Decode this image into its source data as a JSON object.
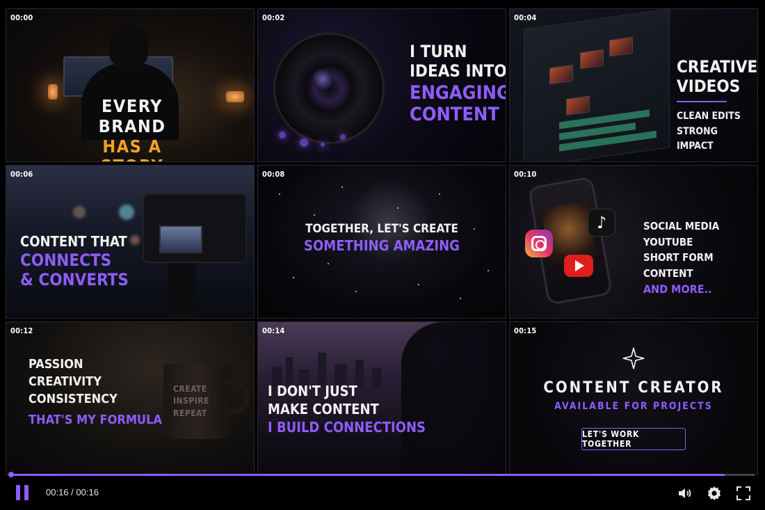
{
  "tiles": [
    {
      "timestamp": "00:00",
      "lines": [
        {
          "text": "EVERY BRAND",
          "color": "#f2f2f2"
        },
        {
          "text": "HAS A STORY",
          "color": "#f0a323"
        }
      ]
    },
    {
      "timestamp": "00:02",
      "lines": [
        {
          "text": "I TURN",
          "color": "#f2f2f2"
        },
        {
          "text": "IDEAS INTO",
          "color": "#f2f2f2"
        },
        {
          "text": "ENGAGING",
          "color": "#8f5cff"
        },
        {
          "text": "CONTENT",
          "color": "#8f5cff"
        }
      ]
    },
    {
      "timestamp": "00:04",
      "lines": [
        {
          "text": "CREATIVE",
          "color": "#f2f2f2"
        },
        {
          "text": "VIDEOS",
          "color": "#f2f2f2"
        },
        {
          "text": "CLEAN EDITS",
          "color": "#f2f2f2"
        },
        {
          "text": "STRONG IMPACT",
          "color": "#f2f2f2"
        }
      ]
    },
    {
      "timestamp": "00:06",
      "lines": [
        {
          "text": "CONTENT THAT",
          "color": "#f2f2f2"
        },
        {
          "text": "CONNECTS",
          "color": "#8f5cff"
        },
        {
          "text": "& CONVERTS",
          "color": "#8f5cff"
        }
      ]
    },
    {
      "timestamp": "00:08",
      "lines": [
        {
          "text": "TOGETHER, LET'S CREATE",
          "color": "#f2f2f2"
        },
        {
          "text": "SOMETHING AMAZING",
          "color": "#8f5cff"
        }
      ]
    },
    {
      "timestamp": "00:10",
      "lines": [
        {
          "text": "SOCIAL MEDIA",
          "color": "#f2f2f2"
        },
        {
          "text": "YOUTUBE",
          "color": "#f2f2f2"
        },
        {
          "text": "SHORT FORM CONTENT",
          "color": "#f2f2f2"
        },
        {
          "text": "AND MORE..",
          "color": "#8f5cff"
        }
      ]
    },
    {
      "timestamp": "00:12",
      "lines": [
        {
          "text": "PASSION",
          "color": "#f2f2f2"
        },
        {
          "text": "CREATIVITY",
          "color": "#f2f2f2"
        },
        {
          "text": "CONSISTENCY",
          "color": "#f2f2f2"
        },
        {
          "text": "THAT'S MY FORMULA",
          "color": "#8f5cff"
        }
      ],
      "mug_text": [
        "CREATE",
        "INSPIRE",
        "REPEAT"
      ]
    },
    {
      "timestamp": "00:14",
      "lines": [
        {
          "text": "I DON'T JUST",
          "color": "#f2f2f2"
        },
        {
          "text": "MAKE CONTENT",
          "color": "#f2f2f2"
        },
        {
          "text": "I BUILD CONNECTIONS",
          "color": "#8f5cff"
        }
      ]
    },
    {
      "timestamp": "00:15",
      "lines": [
        {
          "text": "CONTENT CREATOR",
          "color": "#f2f2f2"
        },
        {
          "text": "AVAILABLE FOR PROJECTS",
          "color": "#8f5cff"
        }
      ],
      "cta": "LET'S WORK TOGETHER"
    }
  ],
  "icons": {
    "sparkle": "sparkle-icon",
    "instagram": "instagram-icon",
    "tiktok": "tiktok-icon",
    "youtube": "youtube-icon"
  },
  "player": {
    "time": "00:16 / 00:16",
    "progress": 0.96,
    "accent": "#8f5cff",
    "play_state": "playing"
  }
}
